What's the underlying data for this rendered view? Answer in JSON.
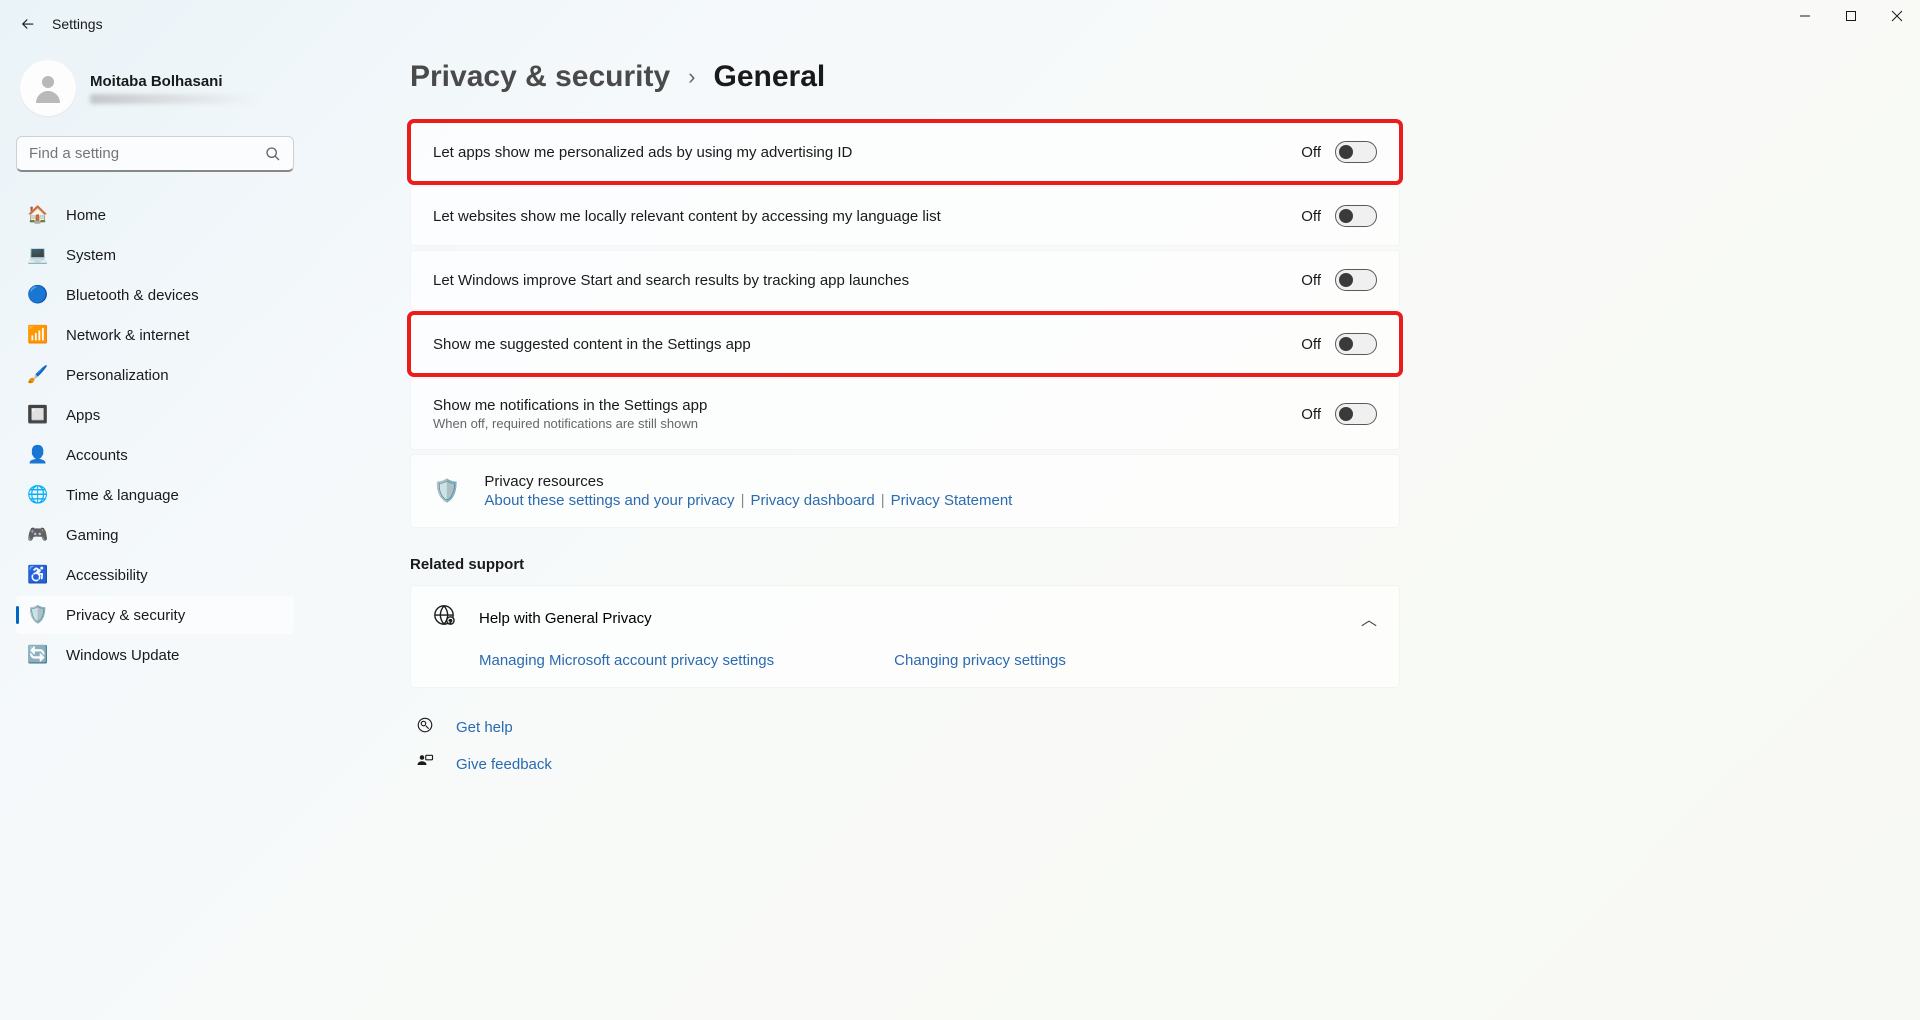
{
  "app": {
    "title": "Settings"
  },
  "profile": {
    "name": "Moitaba Bolhasani"
  },
  "search": {
    "placeholder": "Find a setting"
  },
  "nav": [
    {
      "label": "Home",
      "icon": "🏠"
    },
    {
      "label": "System",
      "icon": "💻"
    },
    {
      "label": "Bluetooth & devices",
      "icon": "🔵"
    },
    {
      "label": "Network & internet",
      "icon": "📶"
    },
    {
      "label": "Personalization",
      "icon": "🖌️"
    },
    {
      "label": "Apps",
      "icon": "🔲"
    },
    {
      "label": "Accounts",
      "icon": "👤"
    },
    {
      "label": "Time & language",
      "icon": "🌐"
    },
    {
      "label": "Gaming",
      "icon": "🎮"
    },
    {
      "label": "Accessibility",
      "icon": "♿"
    },
    {
      "label": "Privacy & security",
      "icon": "🛡️"
    },
    {
      "label": "Windows Update",
      "icon": "🔄"
    }
  ],
  "breadcrumb": {
    "parent": "Privacy & security",
    "current": "General"
  },
  "settings": [
    {
      "title": "Let apps show me personalized ads by using my advertising ID",
      "state": "Off",
      "highlighted": true
    },
    {
      "title": "Let websites show me locally relevant content by accessing my language list",
      "state": "Off",
      "highlighted": false
    },
    {
      "title": "Let Windows improve Start and search results by tracking app launches",
      "state": "Off",
      "highlighted": false
    },
    {
      "title": "Show me suggested content in the Settings app",
      "state": "Off",
      "highlighted": true
    },
    {
      "title": "Show me notifications in the Settings app",
      "sub": "When off, required notifications are still shown",
      "state": "Off",
      "highlighted": false
    }
  ],
  "resources": {
    "title": "Privacy resources",
    "links": [
      "About these settings and your privacy",
      "Privacy dashboard",
      "Privacy Statement"
    ]
  },
  "related": {
    "header": "Related support",
    "help_title": "Help with General Privacy",
    "links": [
      "Managing Microsoft account privacy settings",
      "Changing privacy settings"
    ]
  },
  "footer": {
    "get_help": "Get help",
    "feedback": "Give feedback"
  }
}
